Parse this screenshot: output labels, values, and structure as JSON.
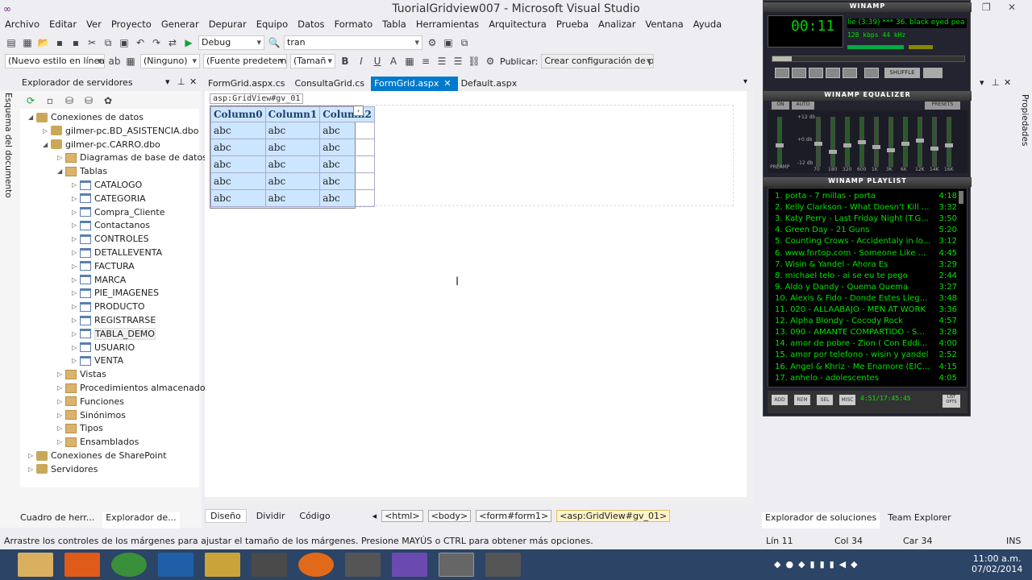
{
  "app": {
    "title": "TuorialGridview007 - Microsoft Visual Studio"
  },
  "menu": [
    "Archivo",
    "Editar",
    "Ver",
    "Proyecto",
    "Generar",
    "Depurar",
    "Equipo",
    "Datos",
    "Formato",
    "Tabla",
    "Herramientas",
    "Arquitectura",
    "Prueba",
    "Analizar",
    "Ventana",
    "Ayuda"
  ],
  "toolbar1": {
    "config": "Debug",
    "find": "tran"
  },
  "toolbar2": {
    "style": "(Nuevo estilo en línea",
    "style2": "(Ninguno)",
    "font": "(Fuente predetern",
    "size": "(Tamañ",
    "publish_label": "Publicar:",
    "publish_value": "Crear configuración de p"
  },
  "left_panel": {
    "title": "Explorador de servidores",
    "vertical_tab": "Esquema del documento",
    "items": [
      {
        "label": "Conexiones de datos",
        "icon": "database-icon"
      },
      {
        "label": "gilmer-pc.BD_ASISTENCIA.dbo",
        "icon": "database-icon"
      },
      {
        "label": "gilmer-pc.CARRO.dbo",
        "icon": "database-icon"
      },
      {
        "label": "Diagramas de base de datos",
        "icon": "folder-icon"
      },
      {
        "label": "Tablas",
        "icon": "folder-icon"
      },
      {
        "label": "CATALOGO",
        "icon": "table-icon"
      },
      {
        "label": "CATEGORIA",
        "icon": "table-icon"
      },
      {
        "label": "Compra_Cliente",
        "icon": "table-icon"
      },
      {
        "label": "Contactanos",
        "icon": "table-icon"
      },
      {
        "label": "CONTROLES",
        "icon": "table-icon"
      },
      {
        "label": "DETALLEVENTA",
        "icon": "table-icon"
      },
      {
        "label": "FACTURA",
        "icon": "table-icon"
      },
      {
        "label": "MARCA",
        "icon": "table-icon"
      },
      {
        "label": "PIE_IMAGENES",
        "icon": "table-icon"
      },
      {
        "label": "PRODUCTO",
        "icon": "table-icon"
      },
      {
        "label": "REGISTRARSE",
        "icon": "table-icon"
      },
      {
        "label": "TABLA_DEMO",
        "icon": "table-icon"
      },
      {
        "label": "USUARIO",
        "icon": "table-icon"
      },
      {
        "label": "VENTA",
        "icon": "table-icon"
      },
      {
        "label": "Vistas",
        "icon": "folder-icon"
      },
      {
        "label": "Procedimientos almacenados",
        "icon": "folder-icon"
      },
      {
        "label": "Funciones",
        "icon": "folder-icon"
      },
      {
        "label": "Sinónimos",
        "icon": "folder-icon"
      },
      {
        "label": "Tipos",
        "icon": "folder-icon"
      },
      {
        "label": "Ensamblados",
        "icon": "folder-icon"
      },
      {
        "label": "Conexiones de SharePoint",
        "icon": "sharepoint-icon"
      },
      {
        "label": "Servidores",
        "icon": "server-icon"
      }
    ],
    "bottom_tabs": [
      "Cuadro de herr...",
      "Explorador de..."
    ]
  },
  "doc_tabs": [
    "FormGrid.aspx.cs",
    "ConsultaGrid.cs",
    "FormGrid.aspx",
    "Default.aspx"
  ],
  "active_tab": "FormGrid.aspx",
  "gridview": {
    "tag": "asp:GridView#gv_01",
    "headers": [
      "Column0",
      "Column1",
      "Column2"
    ],
    "rows": [
      [
        "abc",
        "abc",
        "abc"
      ],
      [
        "abc",
        "abc",
        "abc"
      ],
      [
        "abc",
        "abc",
        "abc"
      ],
      [
        "abc",
        "abc",
        "abc"
      ],
      [
        "abc",
        "abc",
        "abc"
      ]
    ]
  },
  "bottom_bar": {
    "views": [
      "Diseño",
      "Dividir",
      "Código"
    ],
    "crumbs": [
      "<html>",
      "<body>",
      "<form#form1>",
      "<asp:GridView#gv_01>"
    ]
  },
  "right_tabs": [
    "Explorador de soluciones",
    "Team Explorer"
  ],
  "right_vertical_tab": "Propiedades",
  "status": {
    "message": "Arrastre los controles de los márgenes para ajustar el tamaño de los márgenes. Presione MAYÚS o CTRL para obtener más opciones.",
    "line": "Lín 11",
    "col": "Col 34",
    "car": "Car 34",
    "mode": "INS"
  },
  "taskbar": {
    "time": "11:00 a.m.",
    "date": "07/02/2014"
  },
  "winamp": {
    "title": "WINAMP",
    "song": "lie (3:39) *** 36. black eyed pea",
    "kbps": "128",
    "khz": "44",
    "eq_title": "WINAMP EQUALIZER",
    "eq_labels": [
      "70",
      "180",
      "320",
      "600",
      "1K",
      "3K",
      "6K",
      "12K",
      "14K",
      "16K"
    ],
    "eq_db": [
      "+12 db",
      "+0 db",
      "-12 db"
    ],
    "eq_preamp": "PREAMP",
    "eq_buttons": [
      "ON",
      "AUTO",
      "PRESETS"
    ],
    "shuffle": "SHUFFLE",
    "playlist_title": "WINAMP PLAYLIST",
    "playlist": [
      {
        "t": "1. porta - 7 millas - porta",
        "d": "4:18"
      },
      {
        "t": "2. Kelly Clarkson - What Doesn't Kill ...",
        "d": "3:32"
      },
      {
        "t": "3. Katy Perry - Last Friday Night (T.G...",
        "d": "3:50"
      },
      {
        "t": "4. Green Day - 21 Guns",
        "d": "5:20"
      },
      {
        "t": "5. Counting Crows - Accidentaly in lo...",
        "d": "3:12"
      },
      {
        "t": "6. www.fnrtop.com - Someone Like ...",
        "d": "4:45"
      },
      {
        "t": "7. Wisin & Yandel - Ahora Es",
        "d": "3:29"
      },
      {
        "t": "8. michael telo - ai se eu te pego",
        "d": "2:44"
      },
      {
        "t": "9. Aldo y Dandy - Quema Quema",
        "d": "3:27"
      },
      {
        "t": "10. Alexis & Fido - Donde Estes Lleg...",
        "d": "3:48"
      },
      {
        "t": "11. 020 - ALLAABAJO - MEN AT WORK",
        "d": "3:36"
      },
      {
        "t": "12. Alpha Blondy - Cocody Rock",
        "d": "4:57"
      },
      {
        "t": "13. 090 - AMANTE COMPARTIDO - S...",
        "d": "3:28"
      },
      {
        "t": "14. amor de pobre - Zion ( Con Eddi...",
        "d": "4:00"
      },
      {
        "t": "15. amor por telefono - wisin y yandel",
        "d": "2:52"
      },
      {
        "t": "16. Angel & Khriz - Me Enamore (EIC...",
        "d": "4:15"
      },
      {
        "t": "17. anhelo - adolescentes",
        "d": "4:05"
      }
    ],
    "pl_buttons": [
      "ADD",
      "REM",
      "SEL",
      "MISC"
    ],
    "pl_time": "4:51/17:45:45",
    "pl_list_btn": "LIST OPTS"
  }
}
